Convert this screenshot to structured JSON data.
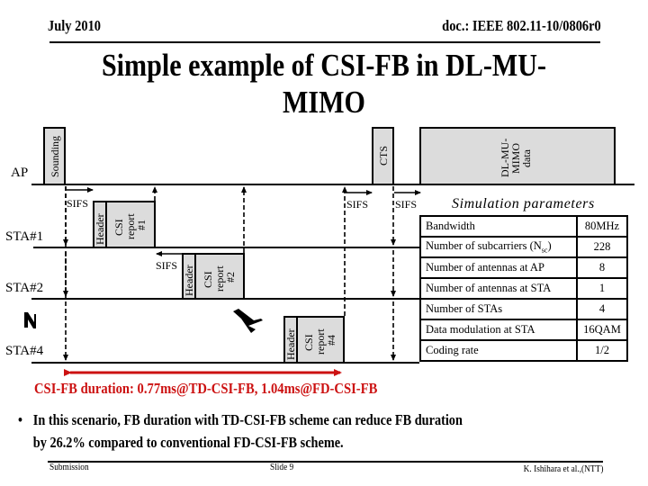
{
  "header": {
    "date": "July 2010",
    "doc_id": "doc.: IEEE 802.11-10/0806r0"
  },
  "title": "Simple example of CSI-FB in DL-MU-MIMO",
  "diagram": {
    "rows": {
      "ap": "AP",
      "sta1": "STA#1",
      "sta2": "STA#2",
      "sta4": "STA#4"
    },
    "frames": {
      "sounding": "Sounding",
      "cts": "CTS",
      "data_line1": "DL-MU-",
      "data_line2": "MIMO",
      "data_line3": "data",
      "header": "Header",
      "csi": "CSI",
      "report": "report",
      "report1_num": "#1",
      "report2_num": "#2",
      "report4_num": "#4"
    },
    "sifs_label": "SIFS",
    "ellipsis_icon": "vertical-ellipsis"
  },
  "simulation": {
    "title": "Simulation parameters",
    "rows": [
      {
        "param": "Bandwidth",
        "value": "80MHz"
      },
      {
        "param": "Number of subcarriers (N",
        "param_sub": "sc",
        "param_end": ")",
        "value": "228"
      },
      {
        "param": "Number of antennas at AP",
        "value": "8"
      },
      {
        "param": "Number of antennas at STA",
        "value": "1"
      },
      {
        "param": "Number of STAs",
        "value": "4"
      },
      {
        "param": "Data modulation at STA",
        "value": "16QAM"
      },
      {
        "param": "Coding rate",
        "value": "1/2"
      }
    ]
  },
  "duration_text": "CSI-FB duration: 0.77ms@TD-CSI-FB, 1.04ms@FD-CSI-FB",
  "bullet": {
    "line1": "In this scenario, FB duration with TD-CSI-FB scheme can reduce FB duration",
    "line2": "by 26.2% compared to conventional FD-CSI-FB scheme."
  },
  "footer": {
    "left": "Submission",
    "center": "Slide 9",
    "right": "K. Ishihara et al.,(NTT)"
  },
  "colors": {
    "frame_fill": "#dcdcdc",
    "duration_red": "#cc1111"
  }
}
